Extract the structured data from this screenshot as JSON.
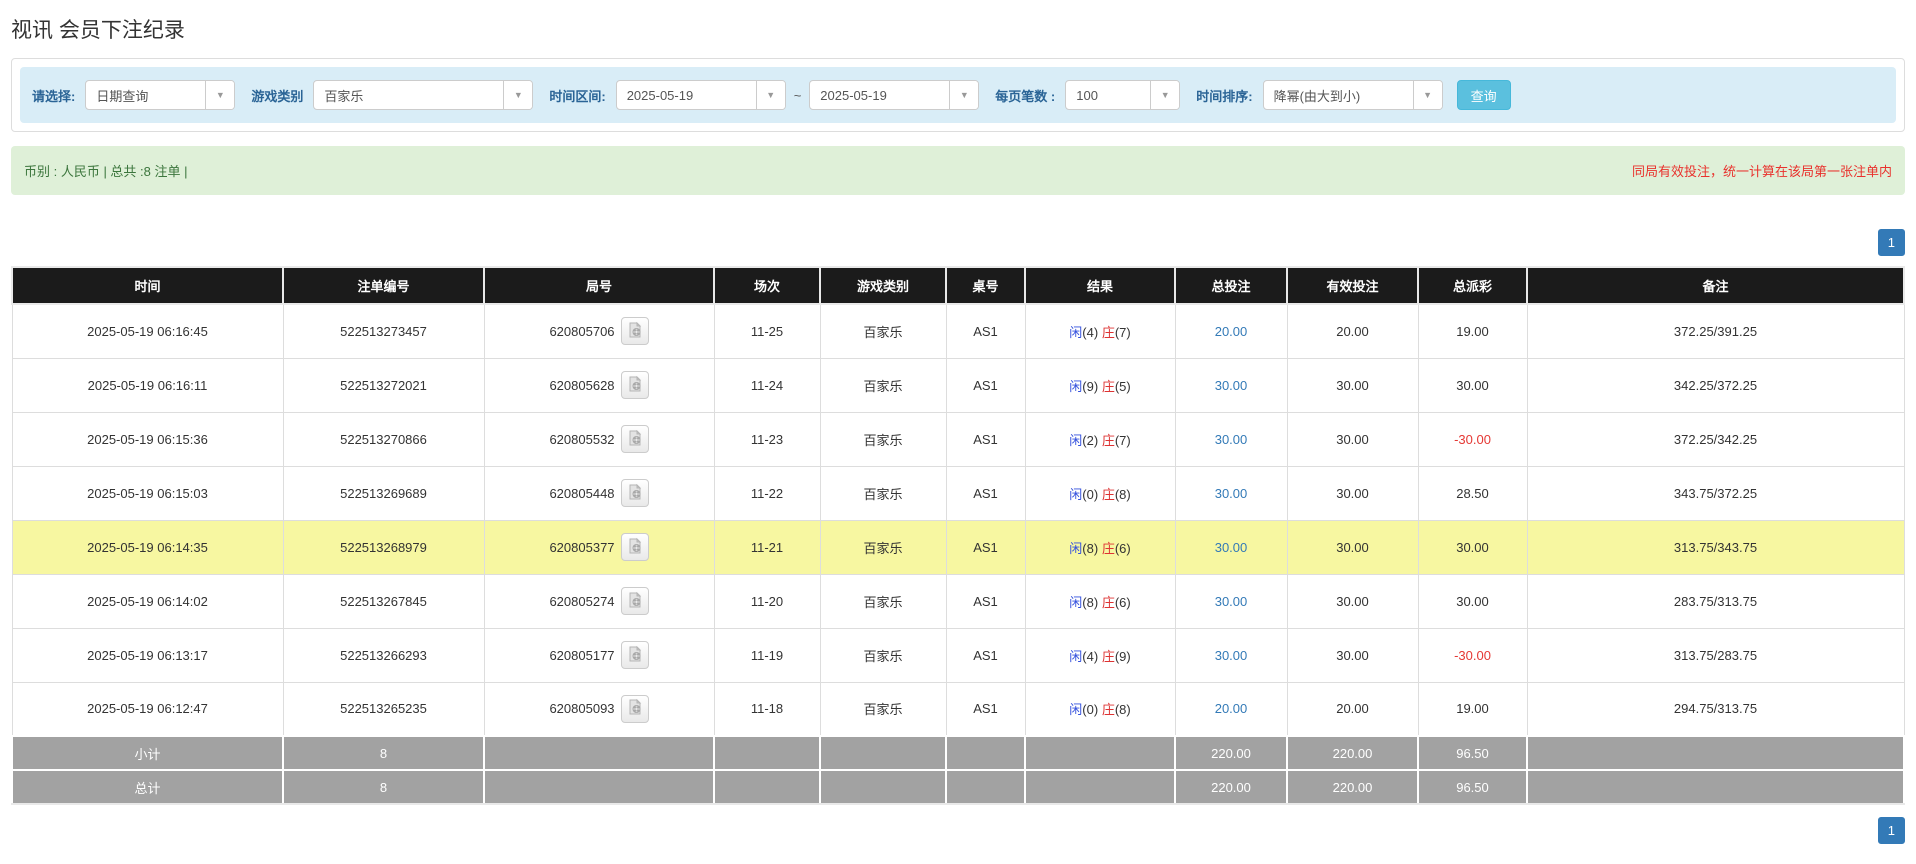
{
  "page_title": "视讯 会员下注纪录",
  "filters": {
    "query_label": "请选择:",
    "query_type": "日期查询",
    "game_label": "游戏类别",
    "game_type": "百家乐",
    "range_label": "时间区间:",
    "date_from": "2025-05-19",
    "range_separator": "~",
    "date_to": "2025-05-19",
    "per_page_label": "每页笔数 :",
    "per_page": "100",
    "sort_label": "时间排序:",
    "sort_order": "降幂(由大到小)",
    "search_label": "查询"
  },
  "summary": {
    "left": "币别 : 人民币 | 总共 :8 注单 |",
    "right": "同局有效投注，统一计算在该局第一张注单内"
  },
  "pagination": {
    "current": "1"
  },
  "colors": {
    "link_blue": "#337ab7",
    "player_blue": "#3350dd",
    "banker_red": "#dd3333",
    "negative_red": "#e53935",
    "summary_green_text": "#3c763d",
    "summary_green_bg": "#dff0d8",
    "warning_red": "#e9322d",
    "filter_bar_bg": "#d9edf7",
    "header_bg": "#1b1b1b",
    "footer_bg": "#a2a2a2",
    "highlight_yellow": "#f7f7a1",
    "search_button_bg": "#5bc0de",
    "pager_blue": "#337ab7"
  },
  "table": {
    "headers": [
      "时间",
      "注单编号",
      "局号",
      "场次",
      "游戏类别",
      "桌号",
      "结果",
      "总投注",
      "有效投注",
      "总派彩",
      "备注"
    ],
    "rows": [
      {
        "time": "2025-05-19 06:16:45",
        "bet_no": "522513273457",
        "round_no": "620805706",
        "session": "11-25",
        "game": "百家乐",
        "table_no": "AS1",
        "res_p": "闲",
        "res_p_n": "(4)",
        "res_b": "庄",
        "res_b_n": "(7)",
        "total_bet": "20.00",
        "valid_bet": "20.00",
        "payout": "19.00",
        "remark": "372.25/391.25",
        "highlighted": false
      },
      {
        "time": "2025-05-19 06:16:11",
        "bet_no": "522513272021",
        "round_no": "620805628",
        "session": "11-24",
        "game": "百家乐",
        "table_no": "AS1",
        "res_p": "闲",
        "res_p_n": "(9)",
        "res_b": "庄",
        "res_b_n": "(5)",
        "total_bet": "30.00",
        "valid_bet": "30.00",
        "payout": "30.00",
        "remark": "342.25/372.25",
        "highlighted": false
      },
      {
        "time": "2025-05-19 06:15:36",
        "bet_no": "522513270866",
        "round_no": "620805532",
        "session": "11-23",
        "game": "百家乐",
        "table_no": "AS1",
        "res_p": "闲",
        "res_p_n": "(2)",
        "res_b": "庄",
        "res_b_n": "(7)",
        "total_bet": "30.00",
        "valid_bet": "30.00",
        "payout": "-30.00",
        "remark": "372.25/342.25",
        "highlighted": false
      },
      {
        "time": "2025-05-19 06:15:03",
        "bet_no": "522513269689",
        "round_no": "620805448",
        "session": "11-22",
        "game": "百家乐",
        "table_no": "AS1",
        "res_p": "闲",
        "res_p_n": "(0)",
        "res_b": "庄",
        "res_b_n": "(8)",
        "total_bet": "30.00",
        "valid_bet": "30.00",
        "payout": "28.50",
        "remark": "343.75/372.25",
        "highlighted": false
      },
      {
        "time": "2025-05-19 06:14:35",
        "bet_no": "522513268979",
        "round_no": "620805377",
        "session": "11-21",
        "game": "百家乐",
        "table_no": "AS1",
        "res_p": "闲",
        "res_p_n": "(8)",
        "res_b": "庄",
        "res_b_n": "(6)",
        "total_bet": "30.00",
        "valid_bet": "30.00",
        "payout": "30.00",
        "remark": "313.75/343.75",
        "highlighted": true
      },
      {
        "time": "2025-05-19 06:14:02",
        "bet_no": "522513267845",
        "round_no": "620805274",
        "session": "11-20",
        "game": "百家乐",
        "table_no": "AS1",
        "res_p": "闲",
        "res_p_n": "(8)",
        "res_b": "庄",
        "res_b_n": "(6)",
        "total_bet": "30.00",
        "valid_bet": "30.00",
        "payout": "30.00",
        "remark": "283.75/313.75",
        "highlighted": false
      },
      {
        "time": "2025-05-19 06:13:17",
        "bet_no": "522513266293",
        "round_no": "620805177",
        "session": "11-19",
        "game": "百家乐",
        "table_no": "AS1",
        "res_p": "闲",
        "res_p_n": "(4)",
        "res_b": "庄",
        "res_b_n": "(9)",
        "total_bet": "30.00",
        "valid_bet": "30.00",
        "payout": "-30.00",
        "remark": "313.75/283.75",
        "highlighted": false
      },
      {
        "time": "2025-05-19 06:12:47",
        "bet_no": "522513265235",
        "round_no": "620805093",
        "session": "11-18",
        "game": "百家乐",
        "table_no": "AS1",
        "res_p": "闲",
        "res_p_n": "(0)",
        "res_b": "庄",
        "res_b_n": "(8)",
        "total_bet": "20.00",
        "valid_bet": "20.00",
        "payout": "19.00",
        "remark": "294.75/313.75",
        "highlighted": false
      }
    ],
    "subtotal": {
      "label": "小计",
      "count": "8",
      "total_bet": "220.00",
      "valid_bet": "220.00",
      "payout": "96.50"
    },
    "grand_total": {
      "label": "总计",
      "count": "8",
      "total_bet": "220.00",
      "valid_bet": "220.00",
      "payout": "96.50"
    }
  }
}
